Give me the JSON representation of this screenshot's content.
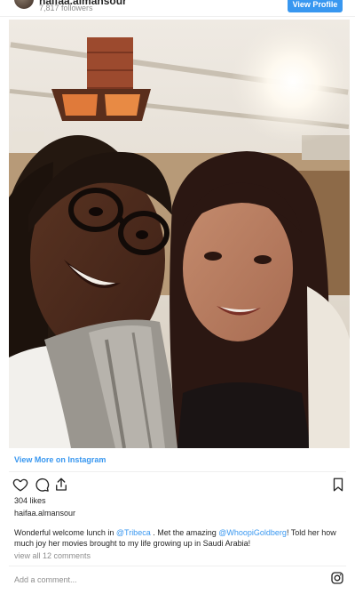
{
  "header": {
    "username": "haifaa.almansour",
    "followers": "7,817 followers",
    "view_profile_label": "View Profile"
  },
  "photo": {
    "icon": "selfie-photo"
  },
  "view_more_label": "View More on Instagram",
  "actions": {
    "like_icon": "heart-icon",
    "comment_icon": "comment-icon",
    "share_icon": "share-icon",
    "save_icon": "bookmark-icon"
  },
  "likes": "304 likes",
  "author": "haifaa.almansour",
  "caption": {
    "part1": "Wonderful welcome lunch in ",
    "mention1": "@Tribeca",
    "part2": " . Met the amazing ",
    "mention2": "@WhoopiGoldberg",
    "part3": "! Told her how much joy her movies brought to my life growing up in Saudi Arabia!"
  },
  "comments_link": "view all 12 comments",
  "comment_input": {
    "placeholder": "Add a comment..."
  },
  "colors": {
    "accent": "#3897f0",
    "text": "#262626",
    "muted": "#8e8e8e"
  }
}
